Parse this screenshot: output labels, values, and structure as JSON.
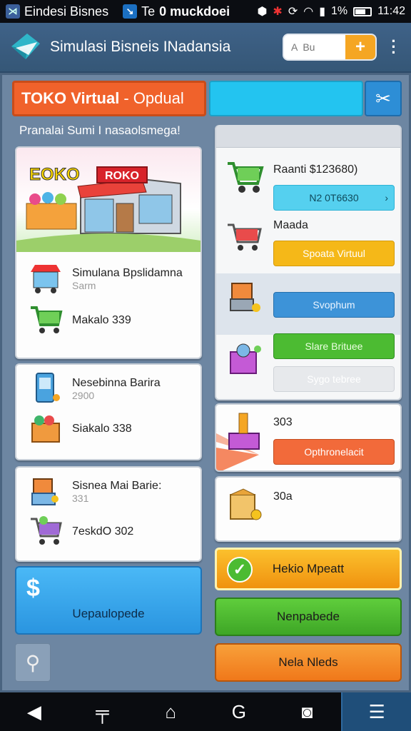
{
  "status_bar": {
    "app1_label": "Eindesi Bisnes",
    "app2_label": "Te",
    "app3_label": "0 muckdoei",
    "signal_text": "1%",
    "time": "11:42"
  },
  "header": {
    "title": "Simulasi Bisneis INadansia",
    "search_placeholder": "A  Bu",
    "add_glyph": "+"
  },
  "tabs": {
    "toko_label": "TOKO Virtual",
    "toko_sub": "- Opdual"
  },
  "welcome_text": "Pranalai Sumi I nasaolsmega!",
  "hero": {
    "sign_left": "EOKO",
    "sign_right": "ROKO"
  },
  "left_items": [
    {
      "title": "Simulana Bpslidamna",
      "sub": "Sarm"
    },
    {
      "title": "Makalo 339",
      "sub": ""
    },
    {
      "title": "Nesebinna Barira",
      "sub": "2900"
    },
    {
      "title": "Siakalo 338",
      "sub": ""
    },
    {
      "title": "Sisnea Mai Barie:",
      "sub": "331"
    },
    {
      "title": "7eskdO 302",
      "sub": ""
    }
  ],
  "right_panel": {
    "price_label": "Raanti $123680)",
    "cyan_button": "N2 0T6630",
    "moada_label": "Maada",
    "yellow_button": "Spoata Virtuul",
    "blue_button": "Svophum",
    "green_button": "Slare Brituee",
    "gray_button": "Sygo tebree",
    "value_1": "303",
    "orange_button": "Opthronelacit",
    "value_2": "30a"
  },
  "buttons": {
    "uepa_label": "Uepaulopede",
    "hekio_label": "Hekio Mpeatt",
    "nenpabede_label": "Nenpabede",
    "nela_label": "Nela Nleds"
  },
  "bottom_nav": [
    "back-icon",
    "menu-icon",
    "home-icon",
    "refresh-icon",
    "camera-icon",
    "tasks-icon"
  ],
  "colors": {
    "accent_orange": "#f0622b",
    "accent_cyan": "#23c4f0",
    "accent_blue": "#2d8ed6",
    "yellow": "#f5b818",
    "green": "#4cbb32"
  }
}
